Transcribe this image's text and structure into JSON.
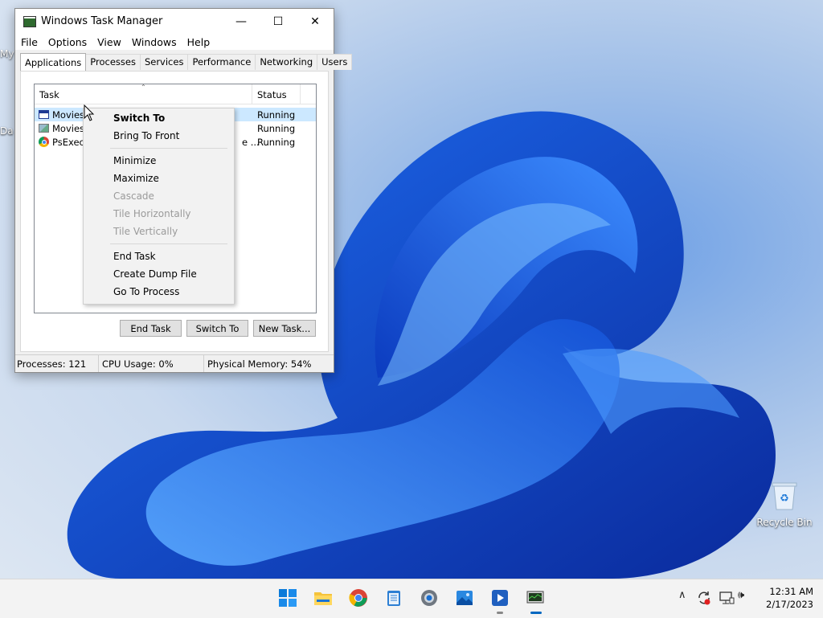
{
  "desktop": {
    "left_labels": [
      "My",
      "Da"
    ],
    "recycle_bin_label": "Recycle Bin"
  },
  "window": {
    "title": "Windows Task Manager",
    "minimize_glyph": "—",
    "maximize_glyph": "☐",
    "close_glyph": "✕",
    "menu": [
      "File",
      "Options",
      "View",
      "Windows",
      "Help"
    ],
    "tabs": [
      "Applications",
      "Processes",
      "Services",
      "Performance",
      "Networking",
      "Users"
    ],
    "active_tab": "Applications"
  },
  "task_list": {
    "columns": {
      "task": "Task",
      "status": "Status"
    },
    "sort_glyph": "⌃",
    "rows": [
      {
        "task": "Movies",
        "status": "Running",
        "icon": "window-icon"
      },
      {
        "task": "Movies a",
        "status": "Running",
        "icon": "app-icon"
      },
      {
        "task": "PsExec",
        "status": "Running",
        "icon": "chrome-icon"
      }
    ],
    "truncated_tail": "e ..."
  },
  "buttons": {
    "end_task": "End Task",
    "switch_to": "Switch To",
    "new_task": "New Task..."
  },
  "status_bar": {
    "processes": "Processes: 121",
    "cpu": "CPU Usage: 0%",
    "memory": "Physical Memory: 54%"
  },
  "context_menu": {
    "switch_to": "Switch To",
    "bring_to_front": "Bring To Front",
    "minimize": "Minimize",
    "maximize": "Maximize",
    "cascade": "Cascade",
    "tile_horizontally": "Tile Horizontally",
    "tile_vertically": "Tile Vertically",
    "end_task": "End Task",
    "create_dump_file": "Create Dump File",
    "go_to_process": "Go To Process"
  },
  "taskbar": {
    "apps": [
      "start-icon",
      "file-explorer-icon",
      "chrome-icon",
      "notepad-icon",
      "settings-icon",
      "photos-icon",
      "media-player-icon",
      "task-manager-icon"
    ],
    "tray_chevron": "∧",
    "volume_glyph": "🕪",
    "time": "12:31 AM",
    "date": "2/17/2023"
  },
  "colors": {
    "selection": "#cce8ff",
    "accent_blue": "#0067c0"
  }
}
